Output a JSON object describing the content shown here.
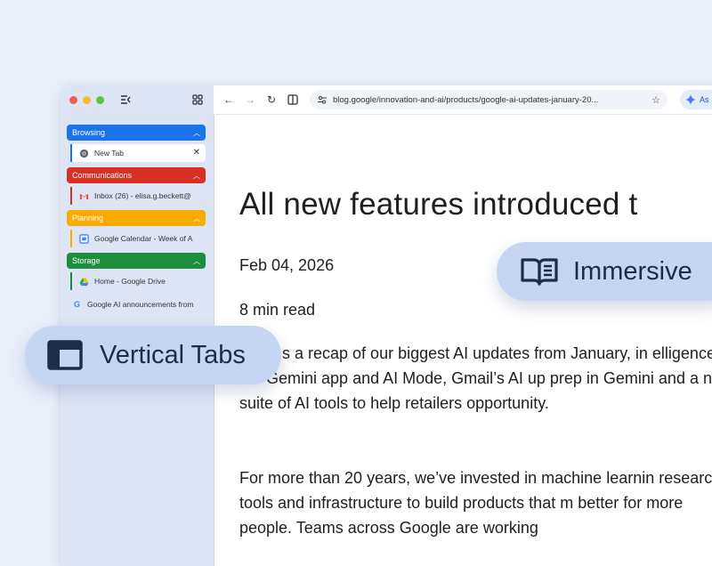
{
  "window": {
    "sidebar": {
      "groups": [
        {
          "name": "Browsing",
          "color": "#1a73e8",
          "tabs": [
            {
              "title": "New Tab",
              "icon": "chrome-icon",
              "active": true
            }
          ]
        },
        {
          "name": "Communications",
          "color": "#d93025",
          "tabs": [
            {
              "title": "Inbox (26) - elisa.g.beckett@",
              "icon": "gmail-icon",
              "active": false
            }
          ]
        },
        {
          "name": "Planning",
          "color": "#f9ab00",
          "tabs": [
            {
              "title": "Google Calendar - Week of A",
              "icon": "calendar-icon",
              "active": false
            }
          ]
        },
        {
          "name": "Storage",
          "color": "#1e8e3e",
          "tabs": [
            {
              "title": "Home - Google Drive",
              "icon": "drive-icon",
              "active": false
            }
          ]
        }
      ],
      "ungrouped_tabs": [
        {
          "title": "Google AI announcements from",
          "icon": "google-icon"
        }
      ]
    },
    "toolbar": {
      "url": "blog.google/innovation-and-ai/products/google-ai-updates-january-20...",
      "gemini_label": "As"
    }
  },
  "article": {
    "headline": "All new features introduced t",
    "date": "Feb 04, 2026",
    "read_time": "8 min read",
    "paragraph1": "s a recap of our biggest AI updates from January, in elligence in the Gemini app and AI Mode, Gmail’s AI up prep in Gemini and a new suite of AI tools to help retailers opportunity.",
    "paragraph2": "For more than 20 years, we’ve invested in machine learnin research, tools and infrastructure to build products that m better for more people. Teams across Google are working"
  },
  "callouts": {
    "vertical_tabs": "Vertical Tabs",
    "immersive": "Immersive"
  },
  "colors": {
    "background": "#e9eef9",
    "sidebar": "#dde5f4",
    "pill": "#c5d5f3"
  }
}
